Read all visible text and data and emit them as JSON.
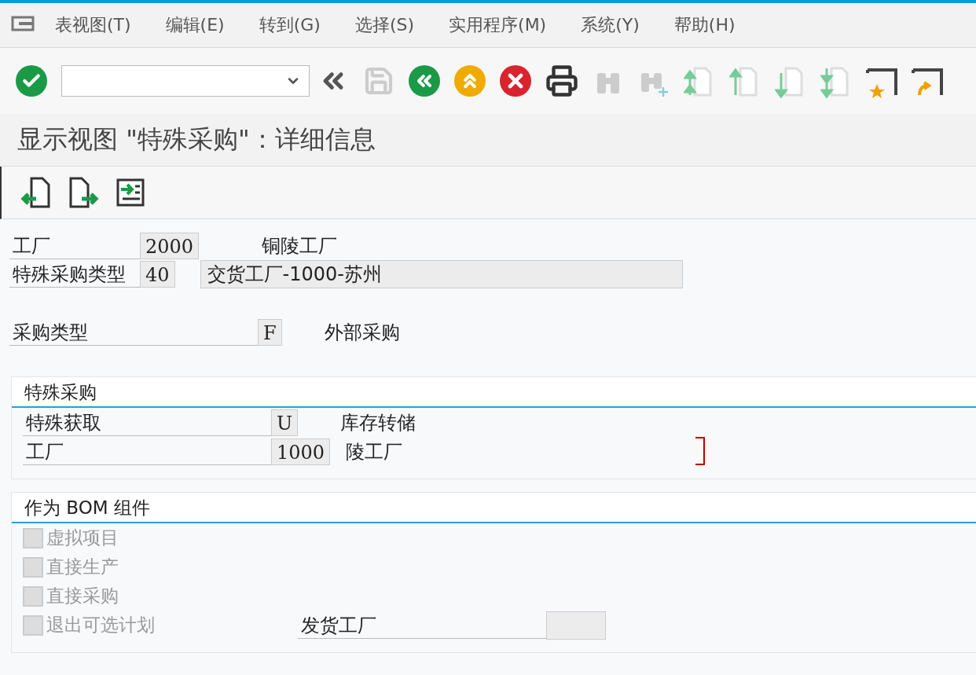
{
  "menu": [
    {
      "label": "表视图(T)"
    },
    {
      "label": "编辑(E)"
    },
    {
      "label": "转到(G)"
    },
    {
      "label": "选择(S)"
    },
    {
      "label": "实用程序(M)"
    },
    {
      "label": "系统(Y)"
    },
    {
      "label": "帮助(H)"
    }
  ],
  "title": "显示视图 \"特殊采购\"：详细信息",
  "header_fields": [
    {
      "label": "工厂",
      "value": "2000",
      "description": "铜陵工厂",
      "kind": "plain"
    },
    {
      "label": "特殊采购类型",
      "value": "40",
      "description": "交货工厂-1000-苏州",
      "kind": "boxed"
    }
  ],
  "procurement_type": {
    "label": "采购类型",
    "value": "F",
    "description": "外部采购"
  },
  "special_procurement": {
    "title": "特殊采购",
    "fields": [
      {
        "label": "特殊获取",
        "value": "U",
        "description": "库存转储",
        "focused": false
      },
      {
        "label": "工厂",
        "value": "1000",
        "description": "陵工厂",
        "focused": true
      }
    ]
  },
  "bom_component": {
    "title": "作为 BOM 组件",
    "checkboxes": [
      {
        "label": "虚拟项目",
        "checked": false,
        "disabled": true
      },
      {
        "label": "直接生产",
        "checked": false,
        "disabled": true
      },
      {
        "label": "直接采购",
        "checked": false,
        "disabled": true
      },
      {
        "label": "退出可选计划",
        "checked": false,
        "disabled": true
      }
    ],
    "issuing_plant": {
      "label": "发货工厂"
    }
  }
}
